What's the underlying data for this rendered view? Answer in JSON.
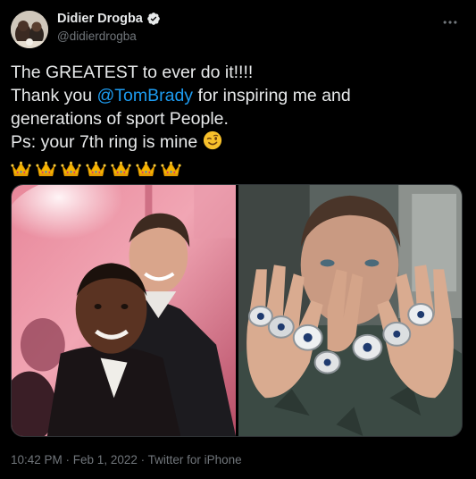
{
  "author": {
    "display_name": "Didier Drogba",
    "handle": "@didierdrogba",
    "verified": true
  },
  "tweet": {
    "line1": "The GREATEST to ever do it!!!!",
    "line2_prefix": "Thank you ",
    "mention": "@TomBrady",
    "line2_suffix": " for inspiring me and",
    "line3": "generations of sport People.",
    "line4": "Ps: your 7th ring is mine",
    "emoji": "winking-face",
    "crown_count": 7
  },
  "media": {
    "photos": [
      {
        "subject": "selfie-two-men"
      },
      {
        "subject": "man-showing-rings"
      }
    ]
  },
  "footer": {
    "time": "10:42 PM",
    "separator1": " · ",
    "date": "Feb 1, 2022",
    "separator2": " · ",
    "source": "Twitter for iPhone"
  },
  "colors": {
    "background": "#000000",
    "text": "#e7e9ea",
    "secondary": "#71767b",
    "link": "#1d9bf0",
    "verified": "#e7e9ea"
  },
  "icons": [
    "avatar",
    "verified-badge-icon",
    "more-options-icon",
    "winking-face-icon",
    "crown-icon"
  ]
}
